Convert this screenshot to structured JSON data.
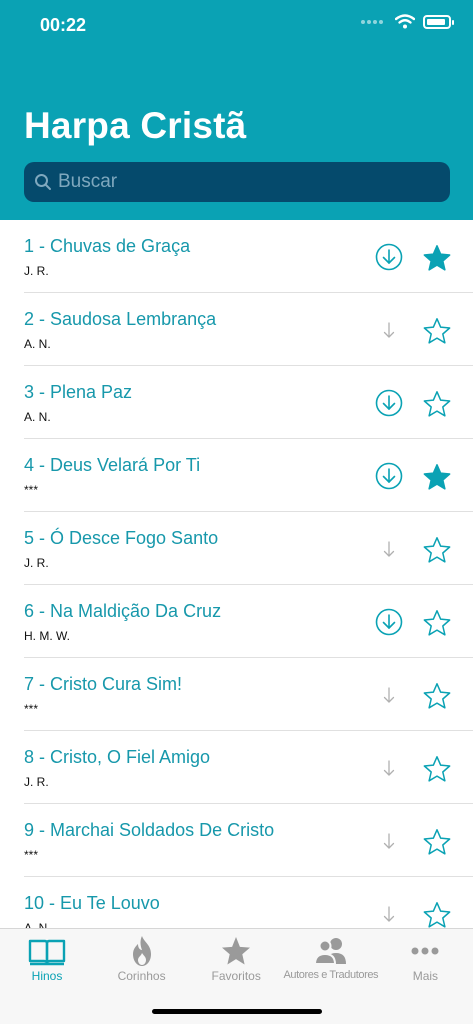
{
  "status": {
    "time": "00:22",
    "battery_level": 0.9
  },
  "header": {
    "title": "Harpa Cristã"
  },
  "search": {
    "placeholder": "Buscar"
  },
  "hymns": [
    {
      "title": "1 - Chuvas de Graça",
      "author": "J. R.",
      "download_icon": "circle-down-arrow-icon",
      "favorite": true
    },
    {
      "title": "2 - Saudosa Lembrança",
      "author": "A. N.",
      "download_icon": "down-arrow-icon",
      "favorite": false
    },
    {
      "title": "3 - Plena Paz",
      "author": "A. N.",
      "download_icon": "circle-down-arrow-icon",
      "favorite": false
    },
    {
      "title": "4 - Deus Velará Por Ti",
      "author": "***",
      "download_icon": "circle-down-arrow-icon",
      "favorite": true
    },
    {
      "title": "5 - Ó Desce Fogo Santo",
      "author": "J. R.",
      "download_icon": "down-arrow-icon",
      "favorite": false
    },
    {
      "title": "6 - Na Maldição Da Cruz",
      "author": "H. M. W.",
      "download_icon": "circle-down-arrow-icon",
      "favorite": false
    },
    {
      "title": "7 - Cristo Cura Sim!",
      "author": "***",
      "download_icon": "down-arrow-icon",
      "favorite": false
    },
    {
      "title": "8 - Cristo, O Fiel Amigo",
      "author": "J. R.",
      "download_icon": "down-arrow-icon",
      "favorite": false
    },
    {
      "title": "9 - Marchai Soldados De Cristo",
      "author": "***",
      "download_icon": "down-arrow-icon",
      "favorite": false
    },
    {
      "title": "10 - Eu Te Louvo",
      "author": "A. N.",
      "download_icon": "down-arrow-icon",
      "favorite": false
    }
  ],
  "tabbar": {
    "tabs": [
      {
        "label": "Hinos",
        "icon": "book-icon",
        "active": true
      },
      {
        "label": "Corinhos",
        "icon": "flame-icon",
        "active": false
      },
      {
        "label": "Favoritos",
        "icon": "star-icon",
        "active": false
      },
      {
        "label": "Autores e Tradutores",
        "icon": "people-icon",
        "active": false
      },
      {
        "label": "Mais",
        "icon": "more-dots-icon",
        "active": false
      }
    ]
  },
  "colors": {
    "accent": "#0aa2b4",
    "search_bg": "#054a6c",
    "inactive": "#9a9a9a",
    "download_gray": "#b0b0b0"
  }
}
